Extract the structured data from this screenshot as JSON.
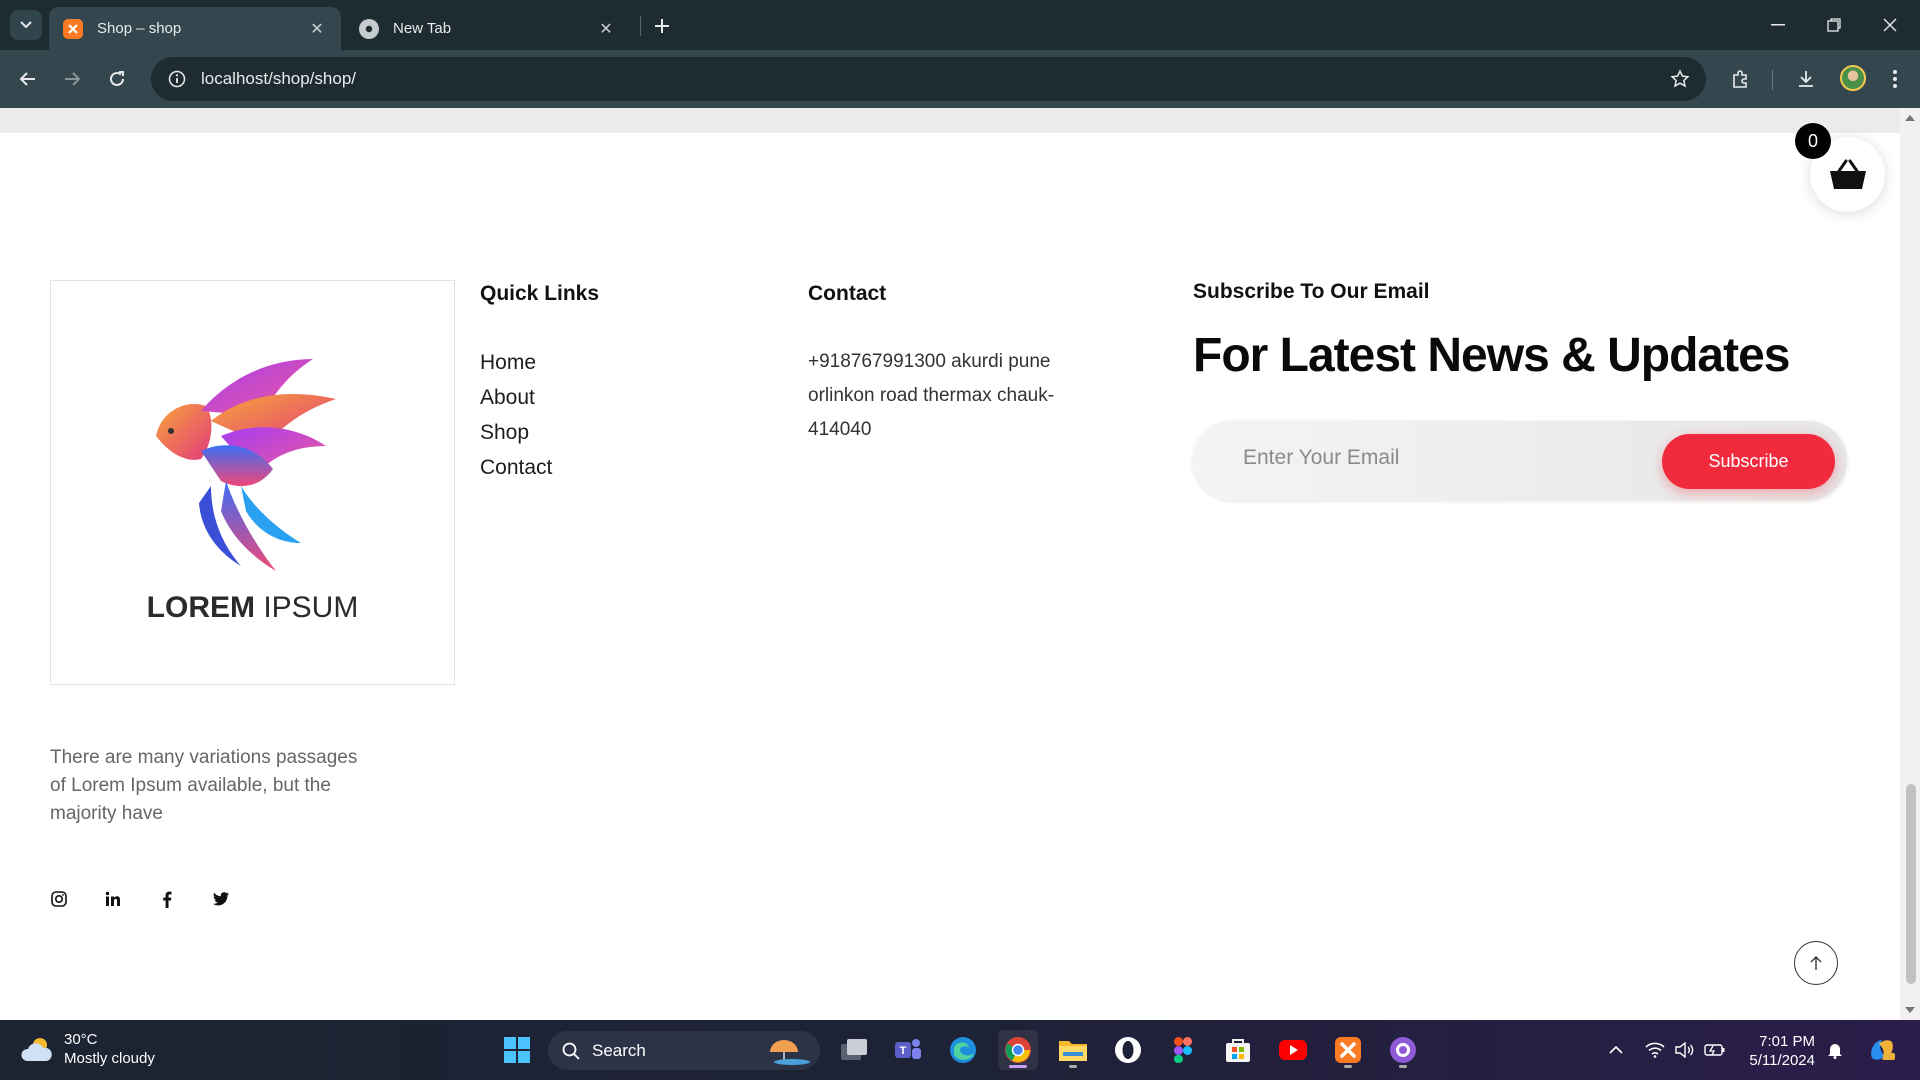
{
  "browser": {
    "tabs": [
      {
        "title": "Shop – shop",
        "active": true
      },
      {
        "title": "New Tab",
        "active": false
      }
    ],
    "url": "localhost/shop/shop/"
  },
  "cart": {
    "count": "0"
  },
  "logo": {
    "text_bold": "LOREM",
    "text_light": " IPSUM"
  },
  "footer": {
    "quick_links": {
      "heading": "Quick Links",
      "items": [
        "Home",
        "About",
        "Shop",
        "Contact"
      ]
    },
    "contact": {
      "heading": "Contact",
      "address": "+918767991300 akurdi pune orlinkon road thermax chauk-414040"
    },
    "subscribe": {
      "title": "Subscribe To Our Email",
      "headline": "For Latest News & Updates",
      "email_placeholder": "Enter Your Email",
      "button_label": "Subscribe"
    },
    "about_text": "There are many variations passages of Lorem Ipsum available, but the majority have",
    "social": [
      "instagram-icon",
      "linkedin-icon",
      "facebook-icon",
      "twitter-icon"
    ]
  },
  "colors": {
    "accent": "#f22a3e",
    "chrome_bg": "#1e2b30",
    "chrome_toolbar": "#34474e"
  },
  "taskbar": {
    "weather": {
      "temp": "30°C",
      "condition": "Mostly cloudy"
    },
    "search_label": "Search",
    "time": "7:01 PM",
    "date": "5/11/2024"
  }
}
